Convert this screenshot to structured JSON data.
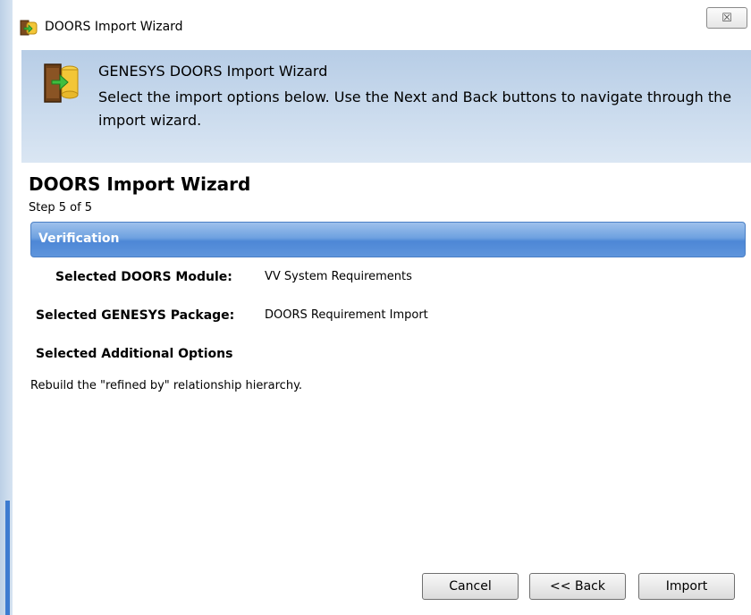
{
  "window": {
    "title": "DOORS Import Wizard",
    "close_glyph": "☒"
  },
  "banner": {
    "title": "GENESYS DOORS Import Wizard",
    "description": "Select the import options below.  Use the Next and Back buttons to navigate through the import wizard."
  },
  "page": {
    "title": "DOORS Import Wizard",
    "step": "Step 5 of 5"
  },
  "section": {
    "label": "Verification"
  },
  "fields": {
    "module_label": "Selected DOORS Module:",
    "module_value": "VV System Requirements",
    "package_label": "Selected GENESYS Package:",
    "package_value": "DOORS Requirement Import",
    "options_label": "Selected Additional Options",
    "options_value": "Rebuild the \"refined by\" relationship hierarchy."
  },
  "buttons": {
    "cancel": "Cancel",
    "back": "<< Back",
    "import": "Import"
  },
  "colors": {
    "banner_top": "#b7cde6",
    "section_bar": "#5e95dc",
    "section_text": "#ffffff"
  }
}
